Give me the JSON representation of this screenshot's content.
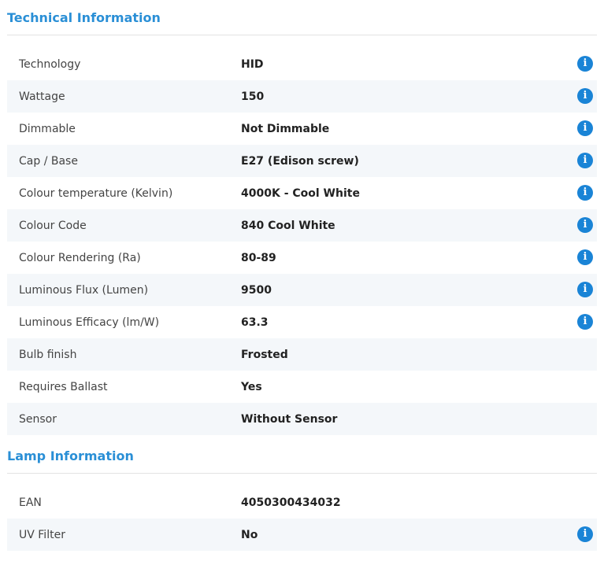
{
  "technical": {
    "title": "Technical Information",
    "rows": [
      {
        "label": "Technology",
        "value": "HID",
        "info": true
      },
      {
        "label": "Wattage",
        "value": "150",
        "info": true
      },
      {
        "label": "Dimmable",
        "value": "Not Dimmable",
        "info": true
      },
      {
        "label": "Cap / Base",
        "value": "E27 (Edison screw)",
        "info": true
      },
      {
        "label": "Colour temperature (Kelvin)",
        "value": "4000K - Cool White",
        "info": true
      },
      {
        "label": "Colour Code",
        "value": "840 Cool White",
        "info": true
      },
      {
        "label": "Colour Rendering (Ra)",
        "value": "80-89",
        "info": true
      },
      {
        "label": "Luminous Flux (Lumen)",
        "value": "9500",
        "info": true
      },
      {
        "label": "Luminous Efficacy (lm/W)",
        "value": "63.3",
        "info": true
      },
      {
        "label": "Bulb finish",
        "value": "Frosted",
        "info": false
      },
      {
        "label": "Requires Ballast",
        "value": "Yes",
        "info": false
      },
      {
        "label": "Sensor",
        "value": "Without Sensor",
        "info": false
      }
    ]
  },
  "lamp": {
    "title": "Lamp Information",
    "rows": [
      {
        "label": "EAN",
        "value": "4050300434032",
        "info": false
      },
      {
        "label": "UV Filter",
        "value": "No",
        "info": true
      }
    ]
  },
  "icons": {
    "info_glyph": "i",
    "info_color": "#1a84d6"
  },
  "colors": {
    "title": "#2a8fd6",
    "shaded_row": "#f4f7fa"
  }
}
